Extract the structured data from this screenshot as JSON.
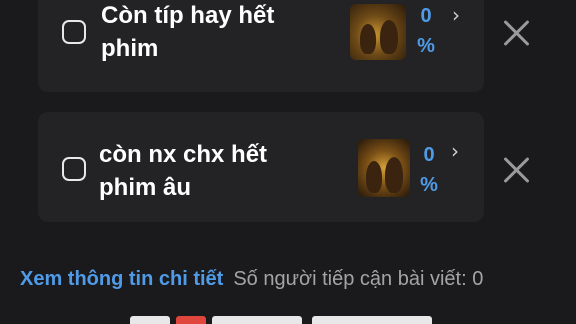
{
  "options": [
    {
      "label": "Còn típ hay hết phim",
      "percent": "0",
      "percent_unit": "%"
    },
    {
      "label": "còn nx chx hết phim âu",
      "percent": "0",
      "percent_unit": "%"
    }
  ],
  "footer": {
    "details_link": "Xem thông tin chi tiết",
    "reach_text": "Số người tiếp cận bài viết: 0"
  },
  "colors": {
    "accent": "#4f9be8",
    "background": "#1a1a1c",
    "card": "#232325"
  },
  "icons": {
    "checkbox": "checkbox-icon",
    "chevron": "chevron-right-icon",
    "remove": "close-icon"
  }
}
